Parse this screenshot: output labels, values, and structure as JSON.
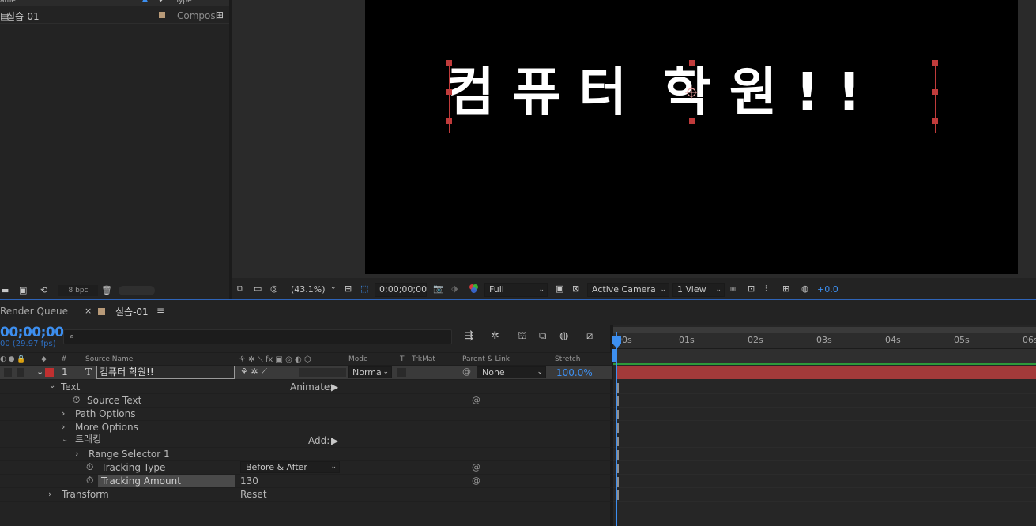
{
  "project": {
    "col_name": "ame",
    "col_type": "Type",
    "item_name": "실습-01",
    "item_type": "Composi",
    "bpc": "8 bpc"
  },
  "viewer": {
    "comp_text": "컴 퓨 터  학 원 ! !",
    "zoom": "(43.1%)",
    "timecode": "0;00;00;00",
    "resolution": "Full",
    "camera": "Active Camera",
    "views": "1 View",
    "exposure": "+0.0"
  },
  "timeline": {
    "tab_render_queue": "Render Queue",
    "tab_comp": "실습-01",
    "timecode": "00;00;00",
    "fps": "00 (29.97 fps)",
    "ruler": [
      "00s",
      "01s",
      "02s",
      "03s",
      "04s",
      "05s",
      "06s"
    ],
    "columns": {
      "num": "#",
      "source_name": "Source Name",
      "mode": "Mode",
      "t": "T",
      "trkmat": "TrkMat",
      "parent": "Parent & Link",
      "stretch": "Stretch"
    },
    "layer": {
      "index": "1",
      "type_glyph": "T",
      "name": "컴퓨터 학원!!",
      "mode": "Norma",
      "parent": "None",
      "stretch": "100.0%"
    },
    "props": {
      "text": "Text",
      "animate": "Animate:",
      "source_text": "Source Text",
      "path_options": "Path Options",
      "more_options": "More Options",
      "animator": "트래킹",
      "add": "Add:",
      "range_selector": "Range Selector 1",
      "tracking_type": "Tracking Type",
      "tracking_type_value": "Before & After",
      "tracking_amount": "Tracking Amount",
      "tracking_amount_value": "130",
      "transform": "Transform",
      "reset": "Reset"
    }
  },
  "colors": {
    "accent_blue": "#3d8ff0",
    "layer_bar": "#a33a3a",
    "label_red": "#c03030",
    "comp_tan": "#b89a78"
  }
}
